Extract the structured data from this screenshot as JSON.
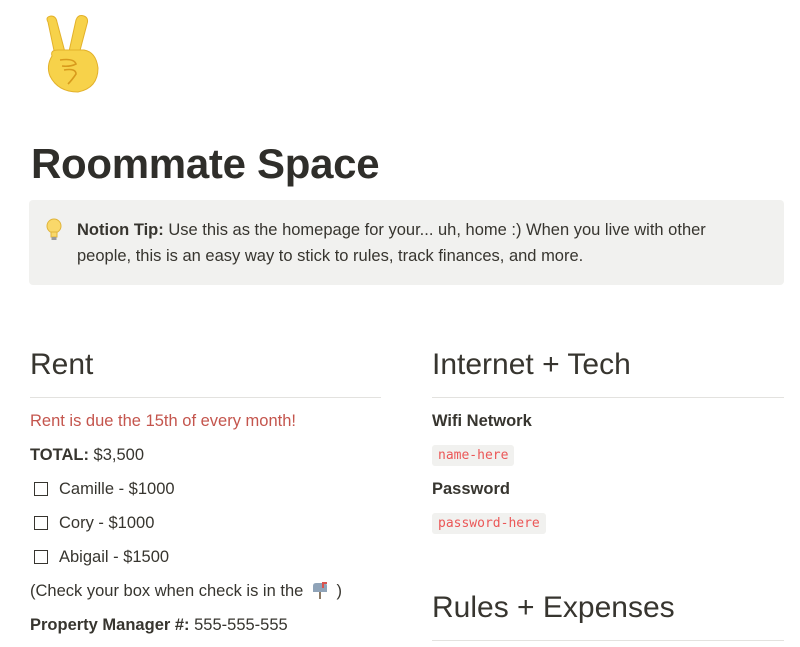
{
  "page": {
    "icon": "victory-hand-emoji",
    "title": "Roommate Space"
  },
  "callout": {
    "icon": "lightbulb-icon",
    "bold": "Notion Tip:",
    "line1": " Use this as the homepage for your... uh, home :) When you live with other",
    "line2": "people, this is an easy way to stick to rules, track finances, and more."
  },
  "rent": {
    "heading": "Rent",
    "due_note": "Rent is due the 15th of every month!",
    "total_label": "TOTAL:",
    "total_value": " $3,500",
    "todos": [
      {
        "label": "Camille - $1000",
        "checked": false
      },
      {
        "label": "Cory - $1000",
        "checked": false
      },
      {
        "label": "Abigail - $1500",
        "checked": false
      }
    ],
    "check_note_before": "(Check your box when check is in the",
    "check_note_icon": "mailbox-icon",
    "check_note_after": ")",
    "manager_label": "Property Manager #:",
    "manager_value": " 555-555-555"
  },
  "internet": {
    "heading": "Internet + Tech",
    "wifi_label": "Wifi Network",
    "wifi_value": "name-here",
    "password_label": "Password",
    "password_value": "password-here"
  },
  "rules": {
    "heading": "Rules + Expenses"
  },
  "colors": {
    "text": "#37352f",
    "accent_red": "#c4554d",
    "code_red": "#eb5757",
    "callout_bg": "#f1f1ef"
  }
}
